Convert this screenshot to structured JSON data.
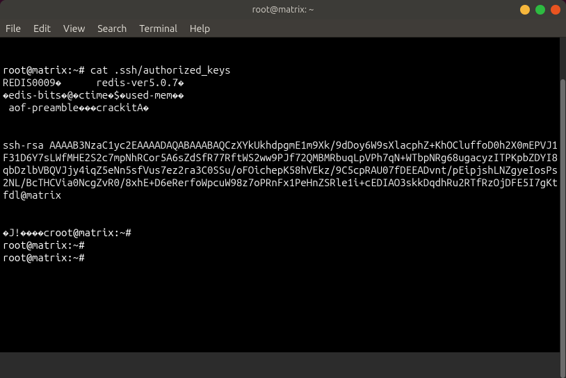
{
  "titlebar": {
    "title": "root@matrix: ~"
  },
  "menubar": {
    "items": [
      "File",
      "Edit",
      "View",
      "Search",
      "Terminal",
      "Help"
    ]
  },
  "terminal": {
    "lines": [
      {
        "prompt": "root@matrix:~# ",
        "cmd": "cat .ssh/authorized_keys"
      },
      {
        "text": "REDIS0009�      redis-ver5.0.7�"
      },
      {
        "text": "�edis-bits�@�ctime�$�used-mem��"
      },
      {
        "text": " aof-preamble���crackitA�"
      },
      {
        "text": ""
      },
      {
        "text": ""
      },
      {
        "text": "ssh-rsa AAAAB3NzaC1yc2EAAAADAQABAAABAQCzXYkUkhdpgmE1m9Xk/9dDoy6W9sXlacphZ+KhOCluffoD0h2X0mEPVJ1F31D6Y7sLWfMHE2S2c7mpNhRCor5A6sZdSfR77RftWS2ww9PJf72QMBMRbuqLpVPh7qN+WTbpNRg68ugacyzITPKpbZDYI8qbDzlbVBQVJjy4iqZ5eNn5sfVus7ez2ra3C0SSu/oFOichepK58hVEkz/9C5cpRAU07fDEEADvnt/pEipjshLNZgyeIosPs2NL/BcTHCVia0NcgZvR0/8xhE+D6eRerfoWpcuW98z7oPRnFx1PeHnZSRle1i+cEDIAO3skkDqdhRu2RTfRzOjDFE5I7gKt fdl@matrix"
      },
      {
        "text": ""
      },
      {
        "text": ""
      },
      {
        "garbage": "�J!����c",
        "prompt": "root@matrix:~# ",
        "cmd": ""
      },
      {
        "prompt": "root@matrix:~# ",
        "cmd": ""
      },
      {
        "prompt": "root@matrix:~# ",
        "cmd": ""
      }
    ]
  }
}
